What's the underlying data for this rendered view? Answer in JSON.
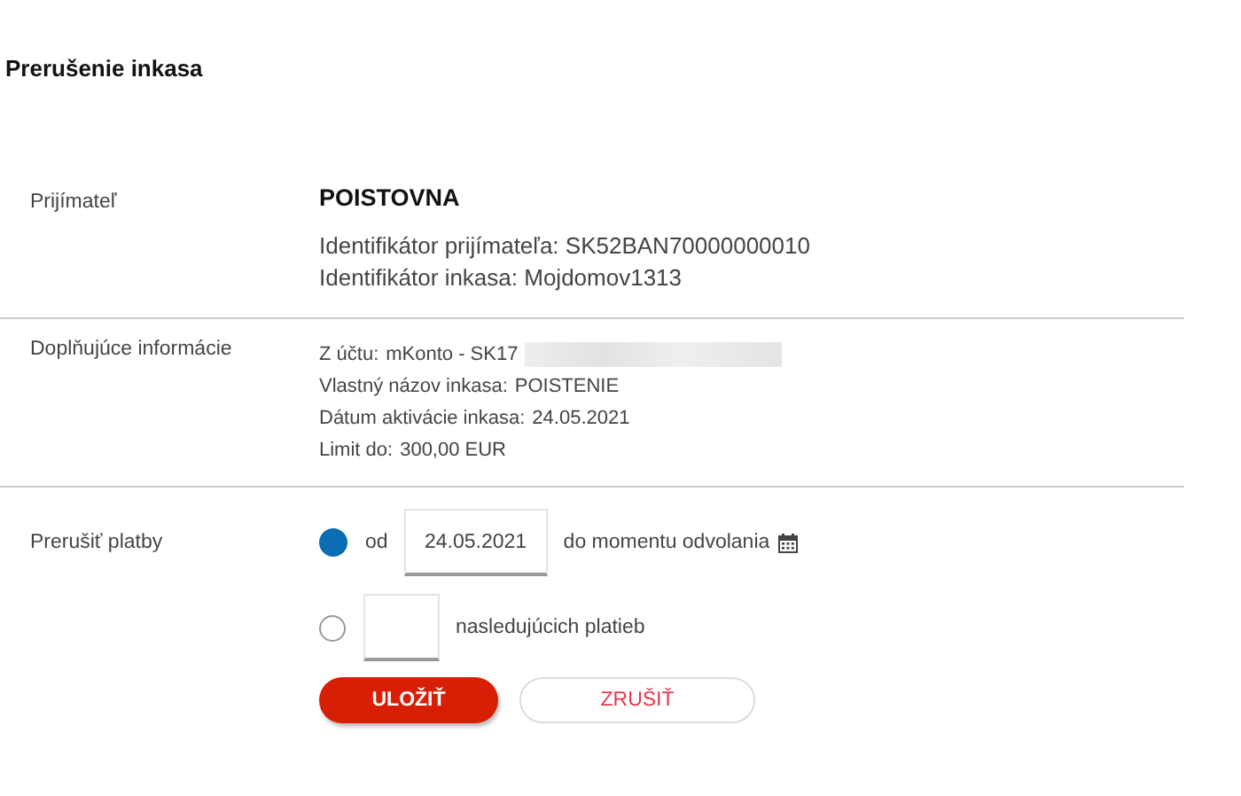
{
  "page": {
    "title": "Prerušenie inkasa"
  },
  "recipient": {
    "label": "Prijímateľ",
    "name": "POISTOVNA",
    "lines": [
      "Identifikátor prijímateľa: SK52BAN70000000010",
      "Identifikátor inkasa: Mojdomov1313"
    ]
  },
  "details": {
    "label": "Doplňujúce informácie",
    "rows": [
      {
        "label": "Z účtu:",
        "value": "mKonto - SK17",
        "redacted": true
      },
      {
        "label": "Vlastný názov inkasa:",
        "value": "POISTENIE"
      },
      {
        "label": "Dátum aktivácie inkasa:",
        "value": "24.05.2021"
      },
      {
        "label": "Limit do:",
        "value": "300,00 EUR"
      }
    ]
  },
  "interrupt": {
    "label": "Prerušiť platby",
    "options": [
      {
        "kind": "date",
        "selected": true,
        "prefix": "od",
        "value": "24.05.2021",
        "suffix": "do momentu odvolania"
      },
      {
        "kind": "count",
        "selected": false,
        "suffix": "nasledujúcich platieb"
      }
    ]
  },
  "buttons": [
    {
      "kind": "primary",
      "label": "ULOŽIŤ"
    },
    {
      "kind": "secondary",
      "label": "ZRUŠIŤ"
    }
  ]
}
